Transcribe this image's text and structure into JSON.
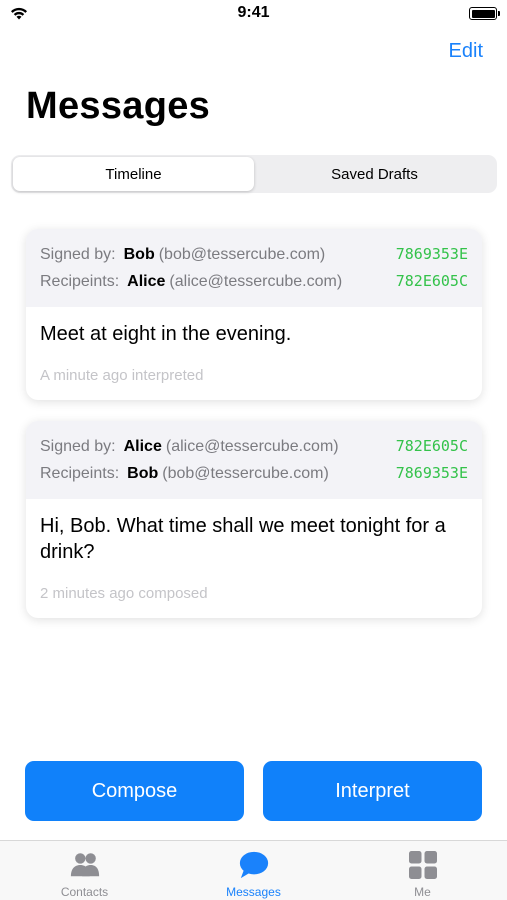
{
  "status_bar": {
    "time": "9:41"
  },
  "header": {
    "edit_label": "Edit",
    "title": "Messages"
  },
  "segmented": {
    "tabs": [
      {
        "label": "Timeline",
        "active": true
      },
      {
        "label": "Saved Drafts",
        "active": false
      }
    ]
  },
  "messages": [
    {
      "signed_label": "Signed by:",
      "signer_name": "Bob",
      "signer_email": "(bob@tessercube.com)",
      "signer_key": "7869353E",
      "recipients_label": "Recipeints:",
      "recipient_name": "Alice",
      "recipient_email": "(alice@tessercube.com)",
      "recipient_key": "782E605C",
      "body": "Meet at eight in the evening.",
      "time": "A minute ago interpreted"
    },
    {
      "signed_label": "Signed by:",
      "signer_name": "Alice",
      "signer_email": "(alice@tessercube.com)",
      "signer_key": "782E605C",
      "recipients_label": "Recipeints:",
      "recipient_name": "Bob",
      "recipient_email": "(bob@tessercube.com)",
      "recipient_key": "7869353E",
      "body": "Hi, Bob. What time shall we meet tonight for a drink?",
      "time": "2 minutes ago composed"
    }
  ],
  "actions": {
    "compose_label": "Compose",
    "interpret_label": "Interpret"
  },
  "tab_bar": {
    "items": [
      {
        "label": "Contacts",
        "icon": "contacts-icon",
        "active": false
      },
      {
        "label": "Messages",
        "icon": "messages-icon",
        "active": true
      },
      {
        "label": "Me",
        "icon": "me-icon",
        "active": false
      }
    ]
  },
  "colors": {
    "accent": "#1a82fb",
    "key": "#33c24a",
    "button": "#1081fa"
  }
}
